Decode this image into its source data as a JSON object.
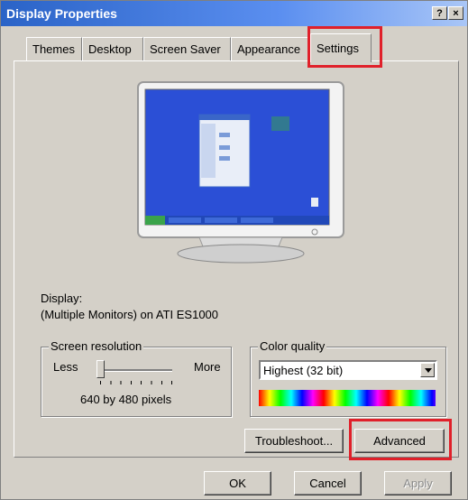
{
  "window": {
    "title": "Display Properties",
    "help_label": "?",
    "close_label": "×"
  },
  "tabs": [
    {
      "label": "Themes"
    },
    {
      "label": "Desktop"
    },
    {
      "label": "Screen Saver"
    },
    {
      "label": "Appearance"
    },
    {
      "label": "Settings",
      "selected": true
    }
  ],
  "display": {
    "label": "Display:",
    "value": "(Multiple Monitors) on ATI ES1000"
  },
  "screen_resolution": {
    "title": "Screen resolution",
    "less_label": "Less",
    "more_label": "More",
    "value": "640 by 480 pixels",
    "slider_position": 0
  },
  "color_quality": {
    "title": "Color quality",
    "selected": "Highest (32 bit)"
  },
  "buttons": {
    "troubleshoot": "Troubleshoot...",
    "advanced": "Advanced",
    "ok": "OK",
    "cancel": "Cancel",
    "apply": "Apply"
  },
  "colors": {
    "titlebar": "#2a63c7",
    "highlight": "#e0202a",
    "desktop": "#2b4fd6"
  }
}
